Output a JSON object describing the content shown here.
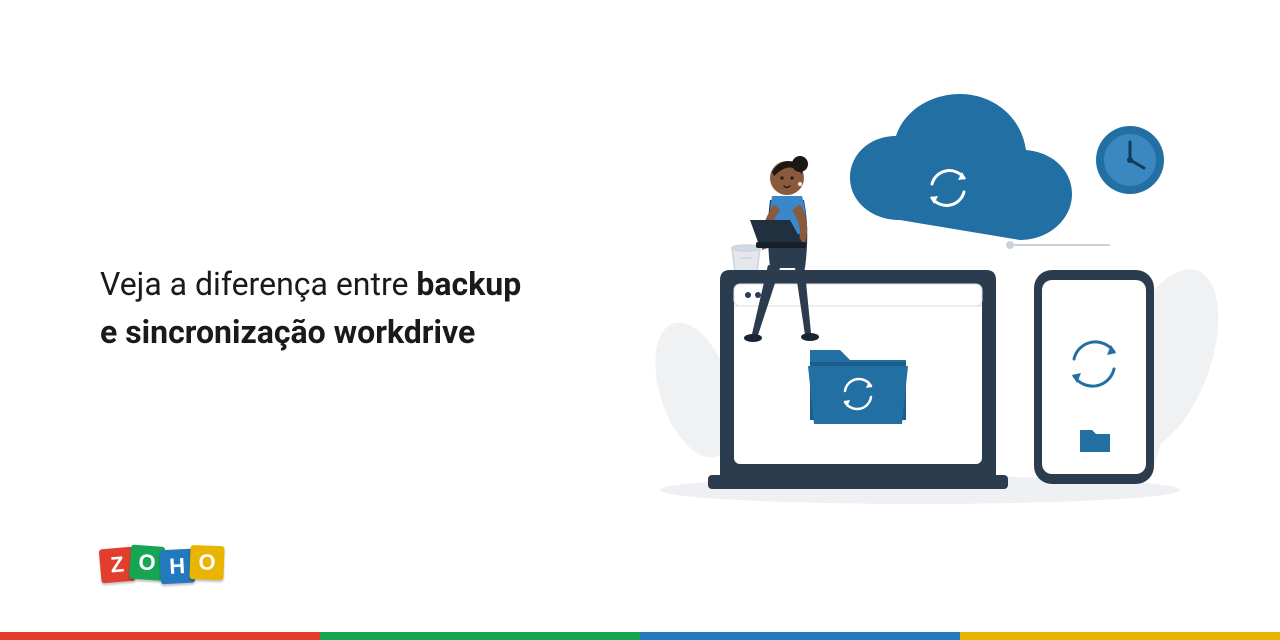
{
  "heading": {
    "line1_prefix": "Veja a diferença entre ",
    "line1_bold": "backup",
    "line2_bold": "e sincronização workdrive"
  },
  "logo": {
    "letters": [
      "Z",
      "O",
      "H",
      "O"
    ],
    "colors": [
      "#e23e2e",
      "#16a552",
      "#2379bd",
      "#e9b500"
    ]
  },
  "illustration": {
    "elements": [
      "person-with-laptop",
      "cloud-sync",
      "wall-clock",
      "laptop-with-folder-sync",
      "phone-with-sync",
      "coffee-cup",
      "plant-leaves"
    ],
    "primary_color": "#226fa3",
    "dark_color": "#2b3c4e",
    "neutral_color": "#e9ebee"
  },
  "footer_bar_colors": [
    "#e23e2e",
    "#16a552",
    "#2379bd",
    "#e9b500"
  ]
}
